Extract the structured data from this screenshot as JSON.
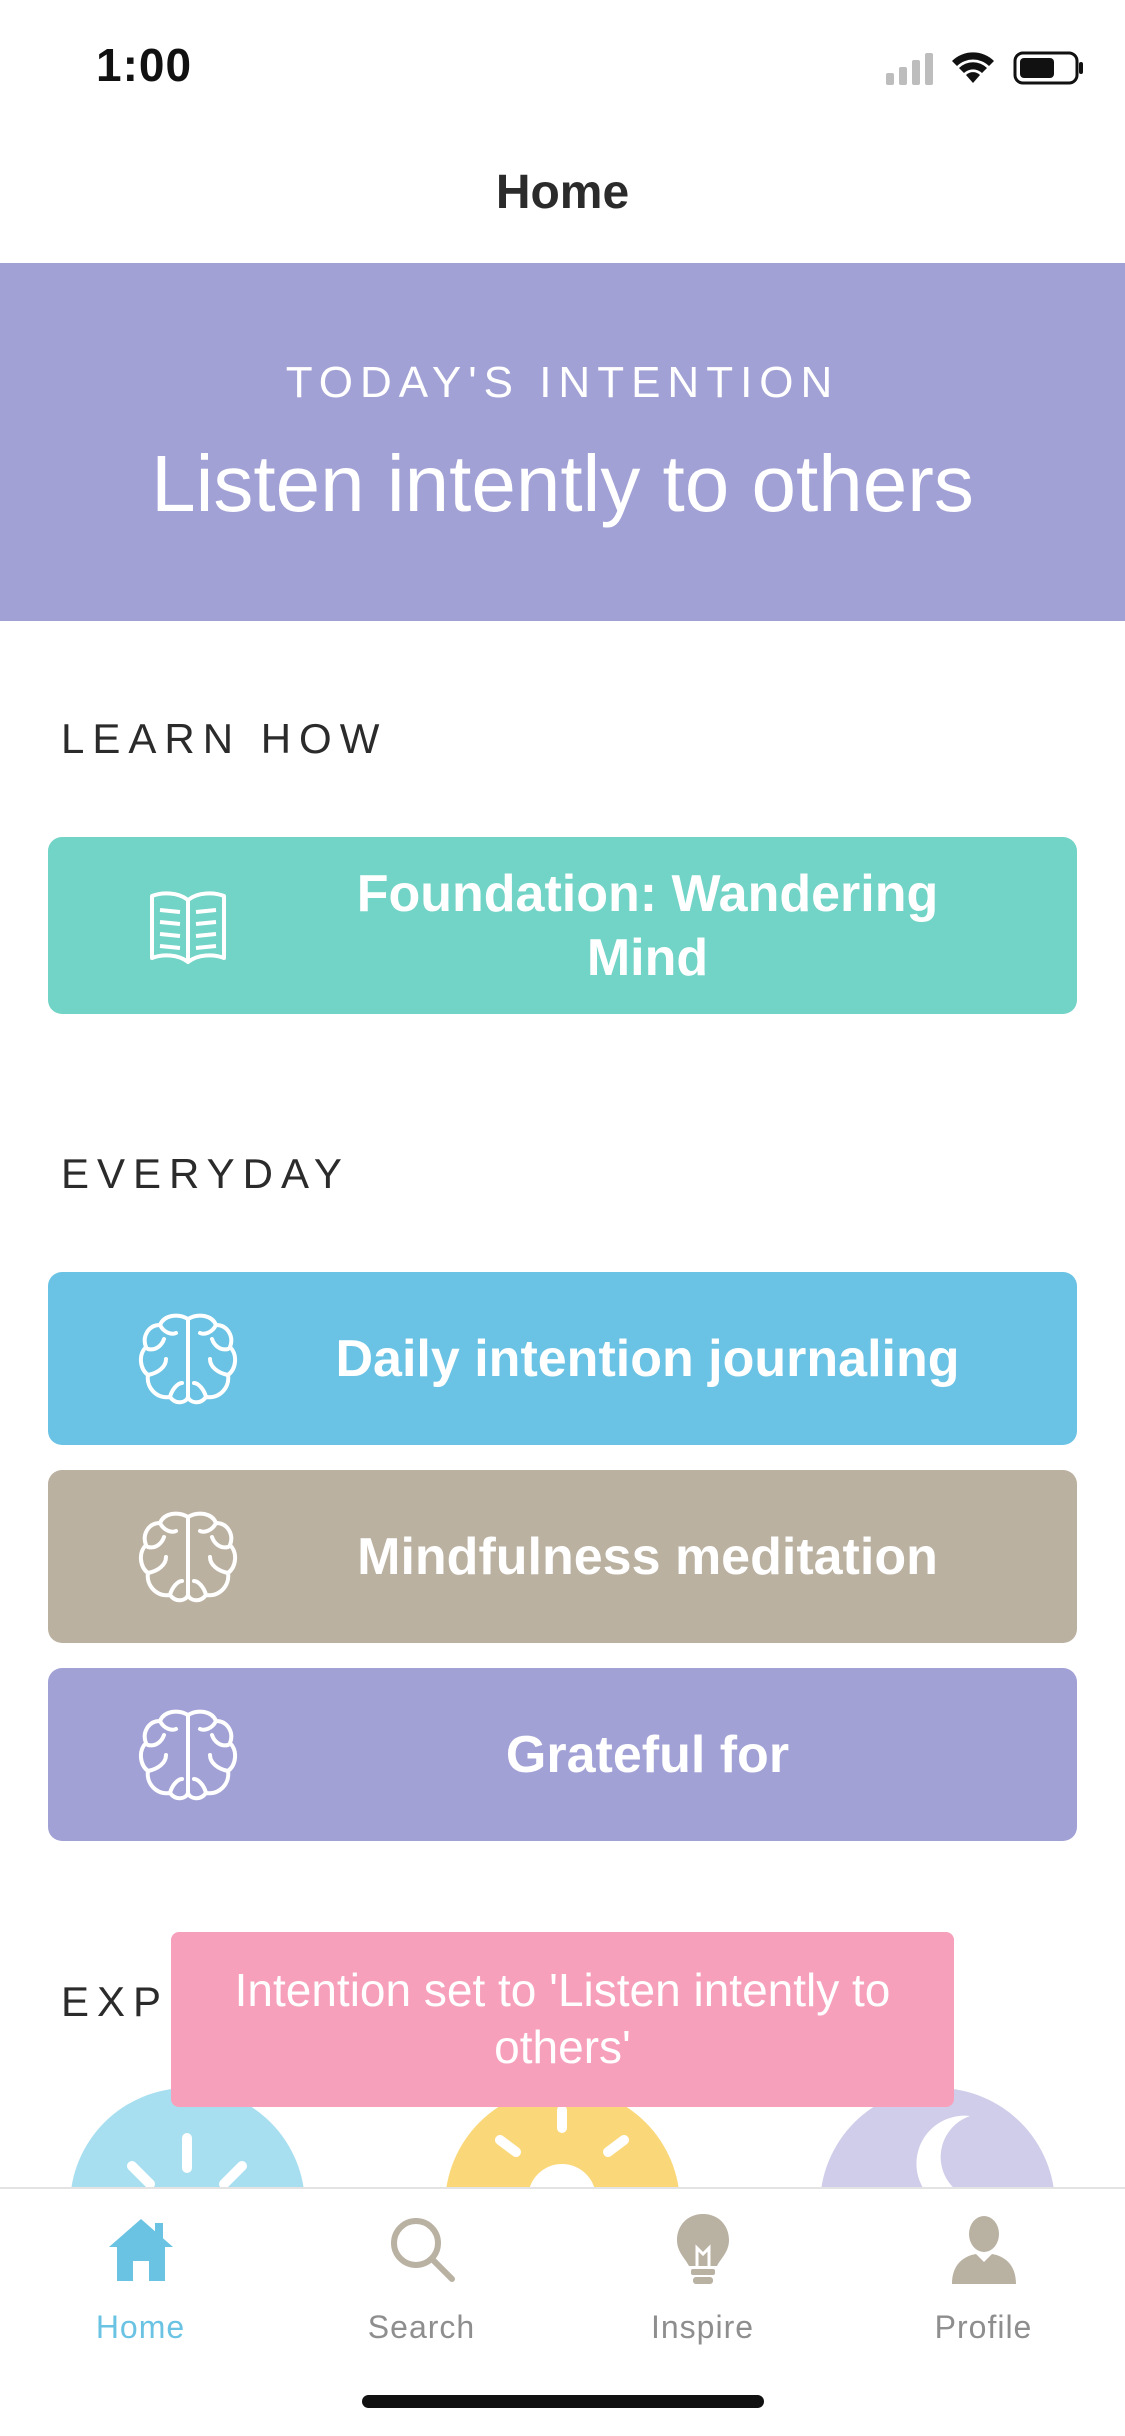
{
  "status_bar": {
    "time": "1:00"
  },
  "nav": {
    "title": "Home"
  },
  "intention": {
    "eyebrow": "TODAY'S INTENTION",
    "text": "Listen intently to others",
    "color": "#a2a1d6"
  },
  "sections": {
    "learn_how": "LEARN HOW",
    "everyday": "EVERYDAY",
    "explore_partial": "EXPL"
  },
  "cards": [
    {
      "label": "Foundation: Wandering Mind",
      "icon": "book-icon",
      "color": "#72d3c7"
    },
    {
      "label": "Daily intention journaling",
      "icon": "brain-icon",
      "color": "#6ac3e4"
    },
    {
      "label": "Mindfulness meditation",
      "icon": "brain-icon",
      "color": "#bbb1a1"
    },
    {
      "label": "Grateful for",
      "icon": "brain-icon",
      "color": "#a2a1d6"
    }
  ],
  "toast": {
    "text": "Intention set to 'Listen intently to others'",
    "color": "#f7a0bb"
  },
  "tabs": [
    {
      "label": "Home",
      "icon": "home-icon",
      "active": true
    },
    {
      "label": "Search",
      "icon": "search-icon",
      "active": false
    },
    {
      "label": "Inspire",
      "icon": "lightbulb-icon",
      "active": false
    },
    {
      "label": "Profile",
      "icon": "profile-icon",
      "active": false
    }
  ],
  "colors": {
    "accent": "#6ac3e3",
    "tab_inactive": "#8e8e8e"
  }
}
